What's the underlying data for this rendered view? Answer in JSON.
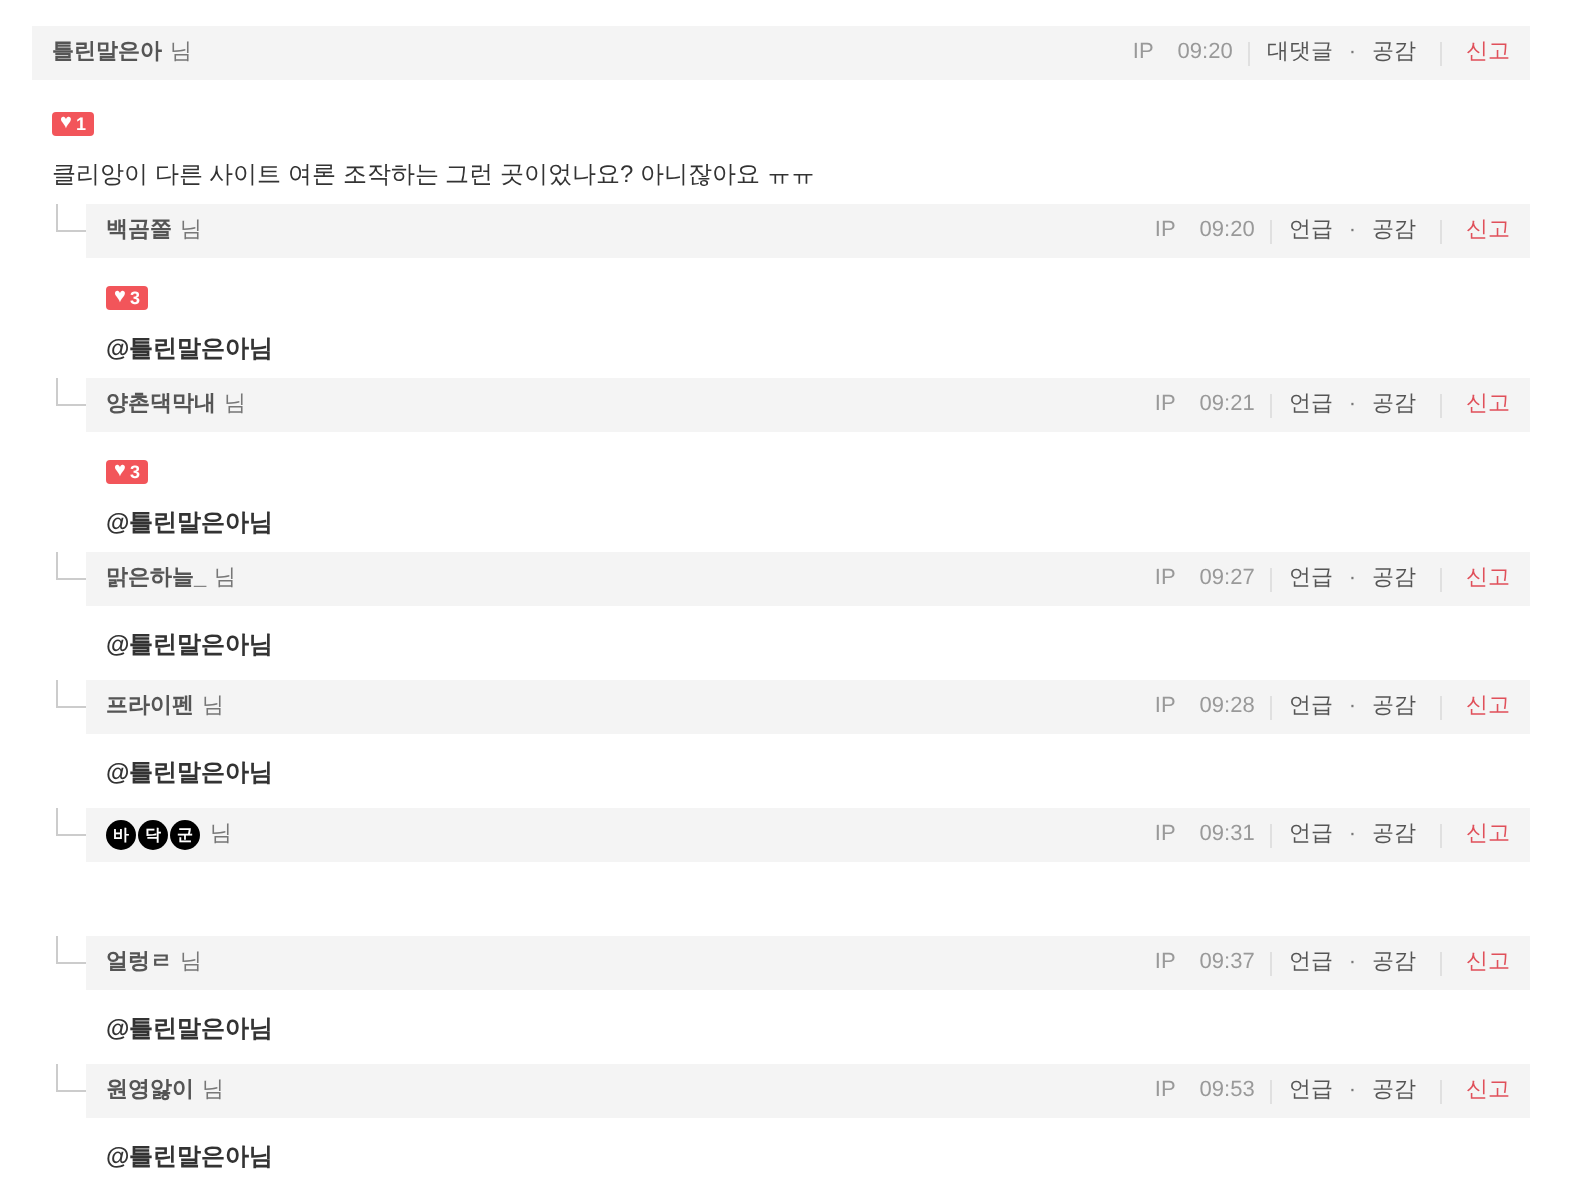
{
  "comment": {
    "nick": "틀린말은아",
    "suffix": "님",
    "ip": "IP",
    "time": "09:20",
    "reply_label": "대댓글",
    "dot": "·",
    "like_label": "공감",
    "report_label": "신고",
    "likes": "1",
    "heart": "♥",
    "text": "클리앙이 다른 사이트 여론 조작하는 그런 곳이었나요? 아니잖아요 ㅠㅠ"
  },
  "replies": [
    {
      "kind": "text",
      "nick": "백곰쫄",
      "suffix": "님",
      "ip": "IP",
      "time": "09:20",
      "mention_label": "언급",
      "dot": "·",
      "like_label": "공감",
      "report_label": "신고",
      "heart": "♥",
      "likes": "3",
      "text": "@틀린말은아님"
    },
    {
      "kind": "text",
      "nick": "양촌댁막내",
      "suffix": "님",
      "ip": "IP",
      "time": "09:21",
      "mention_label": "언급",
      "dot": "·",
      "like_label": "공감",
      "report_label": "신고",
      "heart": "♥",
      "likes": "3",
      "text": "@틀린말은아님"
    },
    {
      "kind": "text",
      "nick": "맑은하늘_",
      "suffix": "님",
      "ip": "IP",
      "time": "09:27",
      "mention_label": "언급",
      "dot": "·",
      "like_label": "공감",
      "report_label": "신고",
      "text": "@틀린말은아님"
    },
    {
      "kind": "text",
      "nick": "프라이펜",
      "suffix": "님",
      "ip": "IP",
      "time": "09:28",
      "mention_label": "언급",
      "dot": "·",
      "like_label": "공감",
      "report_label": "신고",
      "text": "@틀린말은아님"
    },
    {
      "kind": "circled",
      "nick_chars": [
        "바",
        "닥",
        "군"
      ],
      "suffix": "님",
      "ip": "IP",
      "time": "09:31",
      "mention_label": "언급",
      "dot": "·",
      "like_label": "공감",
      "report_label": "신고"
    },
    {
      "kind": "text",
      "nick": "얼렁ㄹ",
      "suffix": "님",
      "ip": "IP",
      "time": "09:37",
      "mention_label": "언급",
      "dot": "·",
      "like_label": "공감",
      "report_label": "신고",
      "text": "@틀린말은아님"
    },
    {
      "kind": "text",
      "nick": "원영앓이",
      "suffix": "님",
      "ip": "IP",
      "time": "09:53",
      "mention_label": "언급",
      "dot": "·",
      "like_label": "공감",
      "report_label": "신고",
      "text": "@틀린말은아님"
    }
  ]
}
